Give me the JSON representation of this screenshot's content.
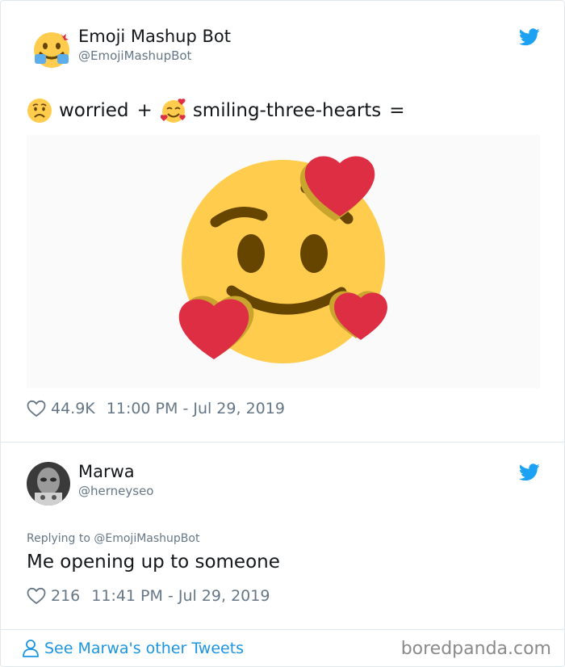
{
  "colors": {
    "link": "#1b95e0",
    "muted": "#657786",
    "text": "#14171a",
    "heart_red": "#dd2e44",
    "emoji_yellow": "#ffcc4d"
  },
  "tweet": {
    "author_name": "Emoji Mashup Bot",
    "author_handle": "@EmojiMashupBot",
    "text_parts": [
      "worried",
      "+",
      "smiling-three-hearts",
      "="
    ],
    "likes": "44.9K",
    "timestamp": "11:00 PM - Jul 29, 2019"
  },
  "reply": {
    "author_name": "Marwa",
    "author_handle": "@herneyseo",
    "replying_to": "Replying to @EmojiMashupBot",
    "text": "Me opening up to someone",
    "likes": "216",
    "timestamp": "11:41 PM - Jul 29, 2019"
  },
  "footer": {
    "see_more": "See Marwa's other Tweets",
    "watermark": "boredpanda.com"
  },
  "icons": {
    "bird": "twitter-bird-icon",
    "like": "heart-outline-icon",
    "person": "person-icon"
  }
}
